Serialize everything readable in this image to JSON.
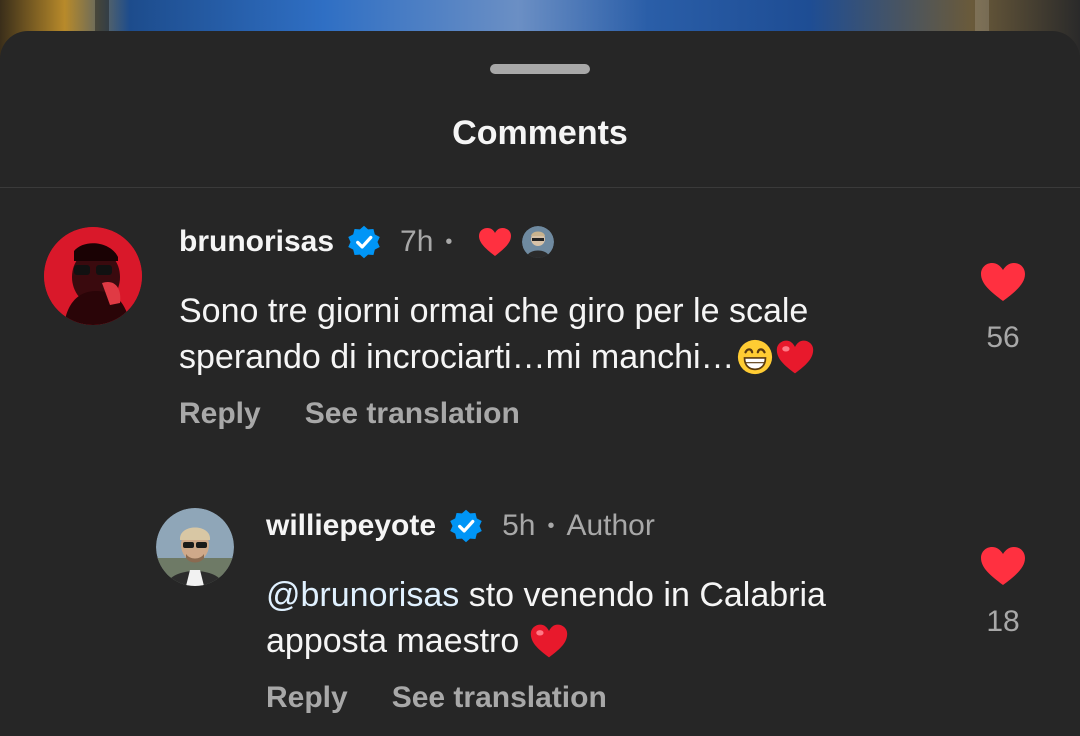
{
  "sheet": {
    "title": "Comments"
  },
  "comments": [
    {
      "username": "brunorisas",
      "time": "7h",
      "dot": "•",
      "text": "Sono tre giorni ormai che giro per le scale sperando di incrociarti…mi manchi…",
      "reply_label": "Reply",
      "translate_label": "See translation",
      "likes": "56",
      "liked_by_author": true
    },
    {
      "username": "williepeyote",
      "time": "5h",
      "dot": "•",
      "author_label": "Author",
      "mention": "@brunorisas",
      "text": " sto venendo in Calabria apposta maestro ",
      "reply_label": "Reply",
      "translate_label": "See translation",
      "likes": "18"
    }
  ],
  "colors": {
    "heart": "#ff3040",
    "verified": "#0095f6",
    "background": "#262626",
    "secondary_text": "#a8a8a8"
  },
  "icons": [
    "verified-badge-icon",
    "heart-icon",
    "grin-emoji",
    "red-heart-emoji"
  ]
}
